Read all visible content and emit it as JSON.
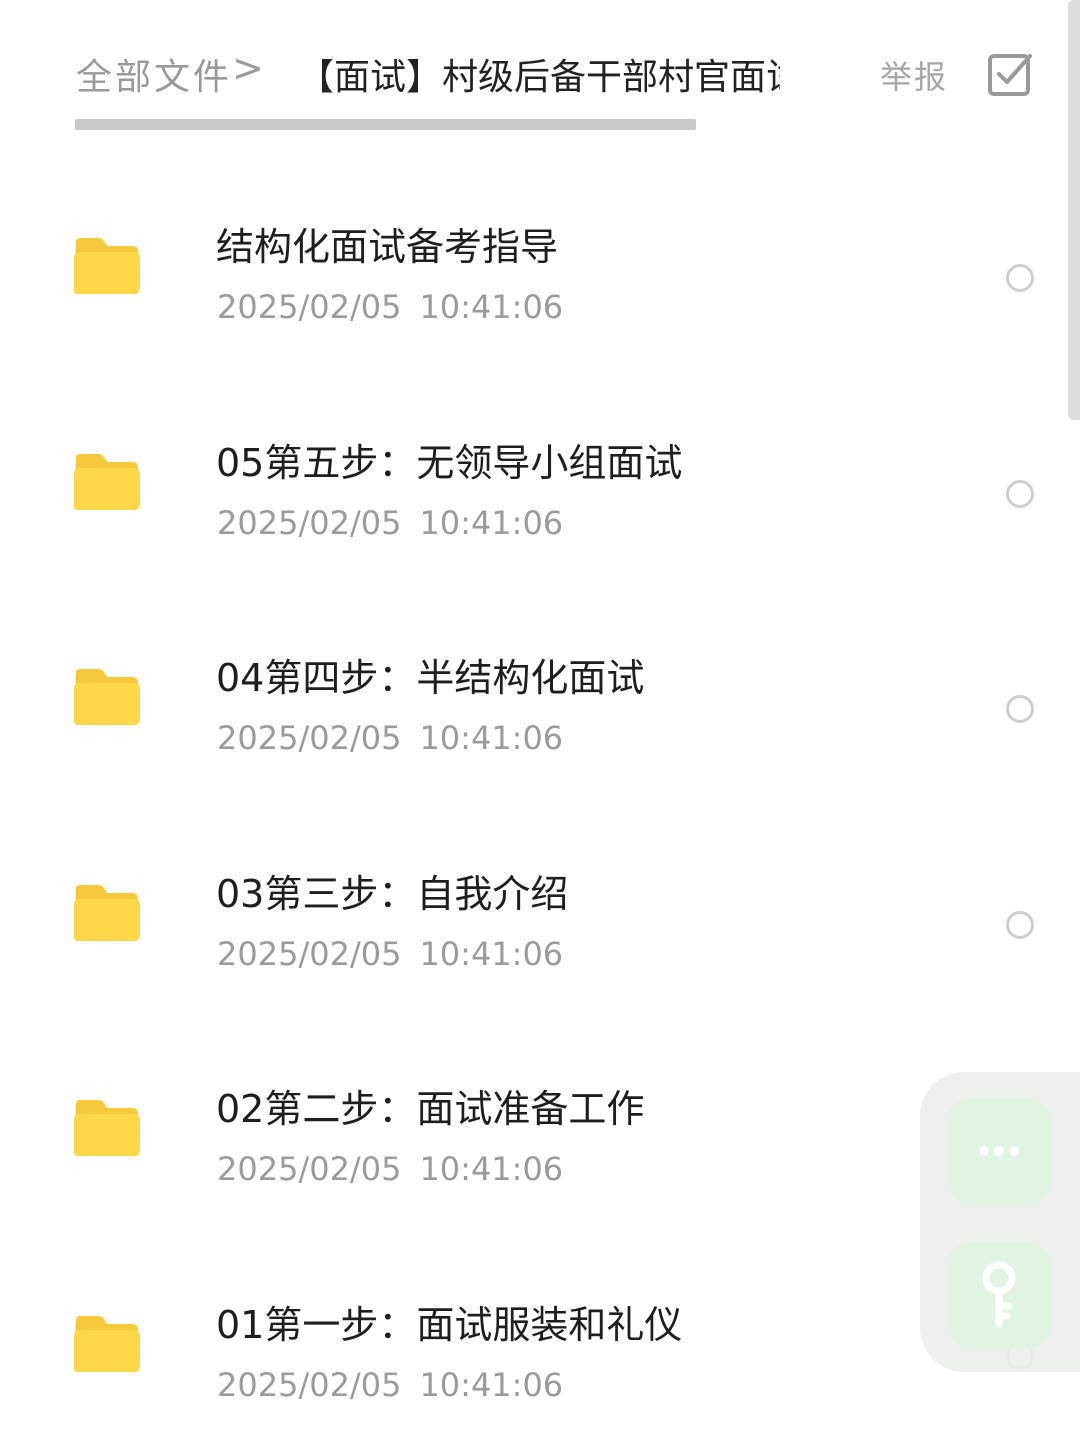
{
  "header": {
    "breadcrumb_root": "全部文件",
    "breadcrumb_separator": ">",
    "breadcrumb_current": "【面试】村级后备干部村官面试",
    "report_label": "举报",
    "select_icon": "checkbox-select-icon"
  },
  "files": [
    {
      "name": "结构化面试备考指导",
      "date": "2025/02/05",
      "time": "10:41:06",
      "icon": "folder-icon"
    },
    {
      "name": "05第五步：无领导小组面试",
      "date": "2025/02/05",
      "time": "10:41:06",
      "icon": "folder-icon"
    },
    {
      "name": "04第四步：半结构化面试",
      "date": "2025/02/05",
      "time": "10:41:06",
      "icon": "folder-icon"
    },
    {
      "name": "03第三步：自我介绍",
      "date": "2025/02/05",
      "time": "10:41:06",
      "icon": "folder-icon"
    },
    {
      "name": "02第二步：面试准备工作",
      "date": "2025/02/05",
      "time": "10:41:06",
      "icon": "folder-icon"
    },
    {
      "name": "01第一步：面试服装和礼仪",
      "date": "2025/02/05",
      "time": "10:41:06",
      "icon": "folder-icon"
    }
  ],
  "floating_panel": {
    "more_icon": "more-dots-icon",
    "key_icon": "key-icon"
  },
  "colors": {
    "folder": "#FFD84A",
    "folder_tab": "#F7C93A",
    "muted_text": "#9B9B9B",
    "primary_text": "#1E1E1E",
    "float_accent": "#CDEFCD"
  }
}
